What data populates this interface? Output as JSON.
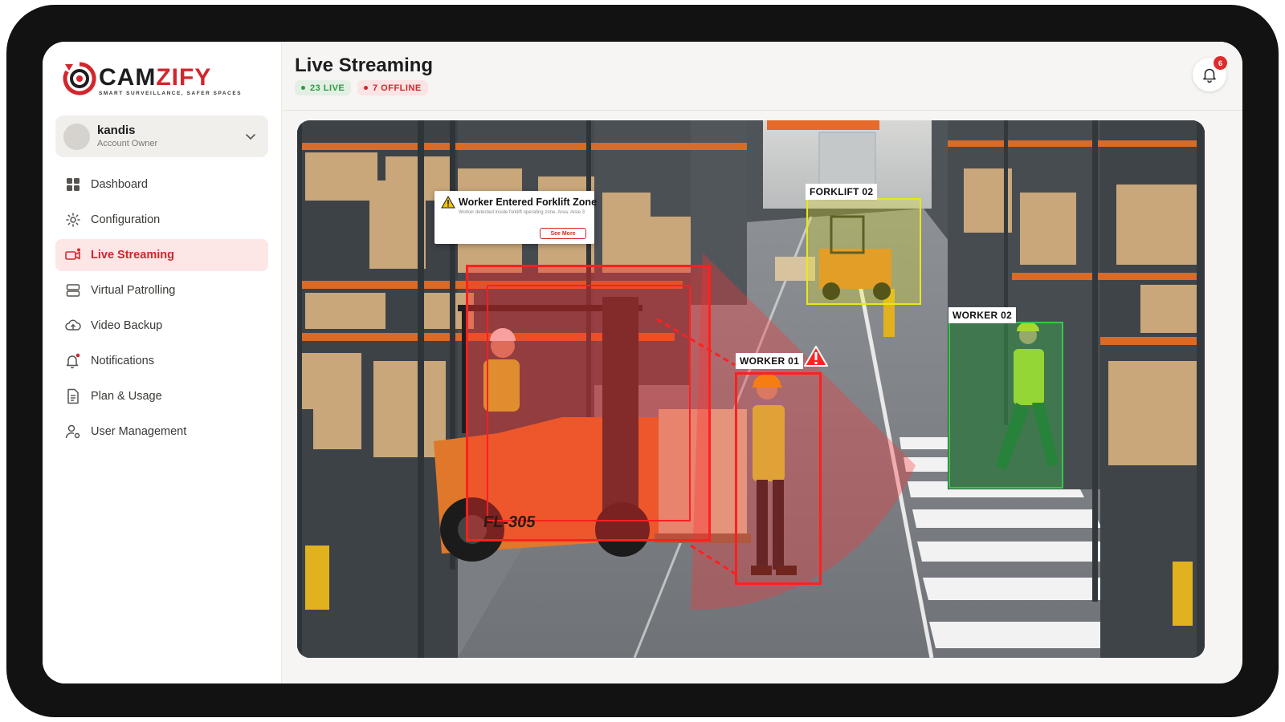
{
  "brand": {
    "name_part1": "CAM",
    "name_part2": "ZIFY",
    "tagline": "SMART SURVEILLANCE, SAFER SPACES"
  },
  "user": {
    "name": "kandis",
    "role": "Account Owner"
  },
  "sidebar": {
    "items": [
      {
        "label": "Dashboard",
        "icon": "grid-icon",
        "active": false
      },
      {
        "label": "Configuration",
        "icon": "gear-icon",
        "active": false
      },
      {
        "label": "Live Streaming",
        "icon": "camera-icon",
        "active": true
      },
      {
        "label": "Virtual Patrolling",
        "icon": "server-icon",
        "active": false
      },
      {
        "label": "Video Backup",
        "icon": "cloud-icon",
        "active": false
      },
      {
        "label": "Notifications",
        "icon": "bell-icon",
        "active": false
      },
      {
        "label": "Plan & Usage",
        "icon": "document-icon",
        "active": false
      },
      {
        "label": "User Management",
        "icon": "user-settings-icon",
        "active": false
      }
    ]
  },
  "header": {
    "title": "Live Streaming",
    "live_badge": "23 LIVE",
    "offline_badge": "7 OFFLINE",
    "notification_count": "6"
  },
  "video": {
    "alert": {
      "title": "Worker Entered Forklift Zone",
      "description": "Worker detected inside forklift operating zone. Area: Aisle 3",
      "button": "See More"
    },
    "detections": {
      "forklift_02": "FORKLIFT 02",
      "worker_01": "WORKER 01",
      "worker_02": "WORKER 02",
      "forklift_plate": "FL-305"
    }
  },
  "colors": {
    "accent": "#d3262c",
    "live": "#2f9a46",
    "danger_zone": "#ff2b2b",
    "forklift_box": "#e8e817",
    "worker_safe_box": "#35c94a"
  }
}
